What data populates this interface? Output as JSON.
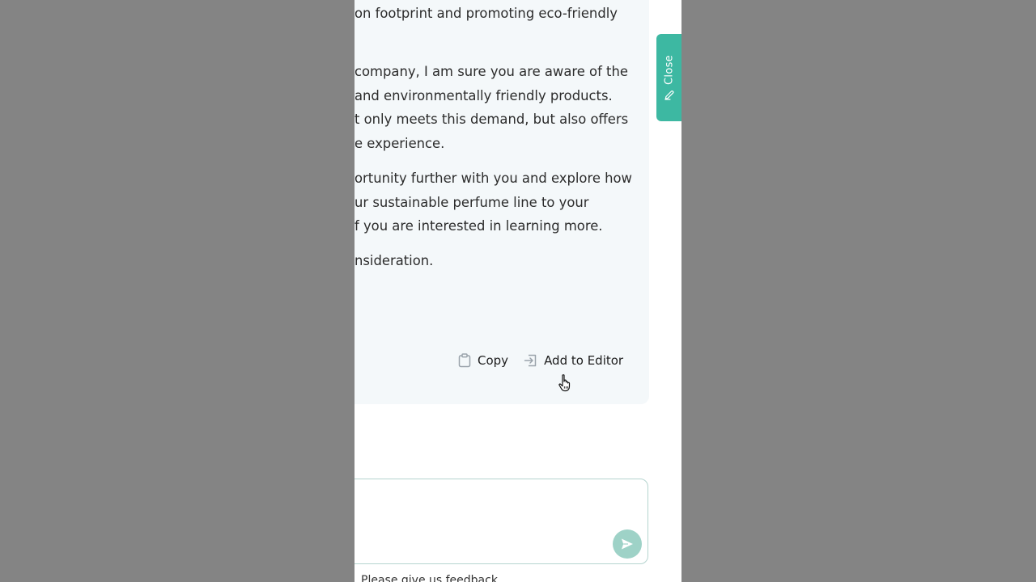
{
  "response": {
    "paragraphs": [
      [
        "on footprint and promoting eco-friendly"
      ],
      [
        "company, I am sure you are aware of the",
        "and environmentally friendly products.",
        "t only meets this demand, but also offers",
        "e experience."
      ],
      [
        "ortunity further with you and explore how",
        "ur sustainable perfume line to your",
        "f you are interested in learning more."
      ],
      [
        "nsideration."
      ]
    ],
    "copy_label": "Copy",
    "add_to_editor_label": "Add to Editor"
  },
  "close_tab": {
    "label": "Close"
  },
  "input": {
    "placeholder": ""
  },
  "feedback_text": "Please give us feedback",
  "colors": {
    "accent": "#3db8a2",
    "send_button": "#9ed2c7",
    "card_background": "#f4f8fa",
    "backdrop": "#848484"
  },
  "icons": {
    "copy": "clipboard-icon",
    "add_to_editor": "import-arrow-icon",
    "close": "pencil-icon",
    "send": "send-icon",
    "cursor": "hand-pointer-icon"
  }
}
